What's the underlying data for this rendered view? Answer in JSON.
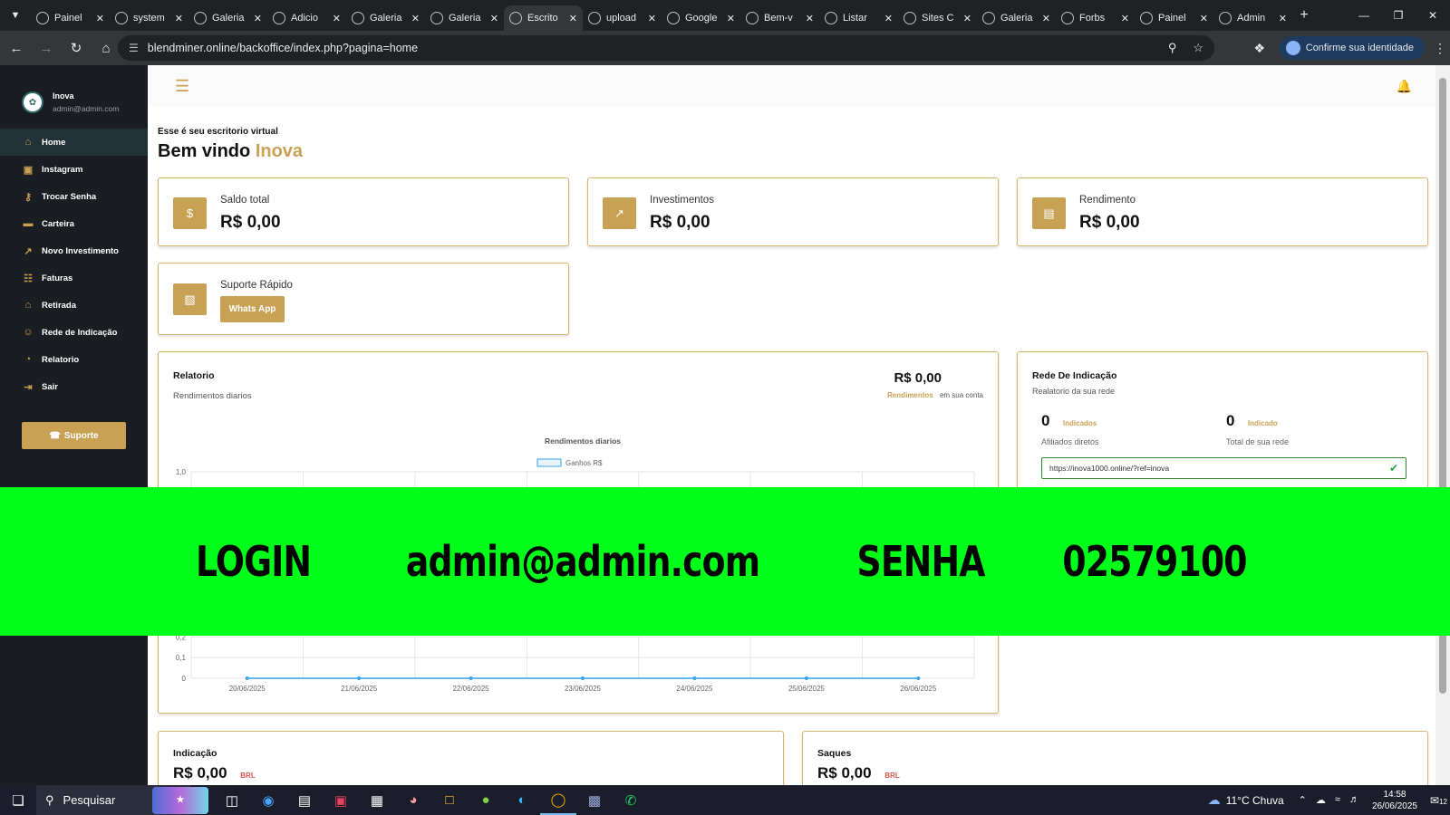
{
  "browser": {
    "tabs": [
      {
        "title": "Painel",
        "icon": "purple-app-icon"
      },
      {
        "title": "system",
        "icon": "globe-icon"
      },
      {
        "title": "Galeria",
        "icon": "globe-icon"
      },
      {
        "title": "Adicio",
        "icon": "globe-icon"
      },
      {
        "title": "Galeria",
        "icon": "globe-icon"
      },
      {
        "title": "Galeria",
        "icon": "globe-icon"
      },
      {
        "title": "Escrito",
        "icon": "gold-site-icon",
        "active": true
      },
      {
        "title": "upload",
        "icon": "blue-site-icon"
      },
      {
        "title": "Google",
        "icon": "gemini-icon"
      },
      {
        "title": "Bem-v",
        "icon": "google-icon"
      },
      {
        "title": "Listar",
        "icon": "globe-icon"
      },
      {
        "title": "Sites C",
        "icon": "globe-icon"
      },
      {
        "title": "Galeria",
        "icon": "globe-icon"
      },
      {
        "title": "Forbs",
        "icon": "chart-site-icon"
      },
      {
        "title": "Painel",
        "icon": "globe-icon"
      },
      {
        "title": "Admin",
        "icon": "globe-icon"
      }
    ],
    "url": "blendminer.online/backoffice/index.php?pagina=home",
    "identity_label": "Confirme sua identidade"
  },
  "sidebar": {
    "user_name": "Inova",
    "user_email": "admin@admin.com",
    "items": [
      {
        "label": "Home",
        "icon": "home-icon"
      },
      {
        "label": "Instagram",
        "icon": "instagram-icon"
      },
      {
        "label": "Trocar Senha",
        "icon": "key-icon"
      },
      {
        "label": "Carteira",
        "icon": "wallet-icon"
      },
      {
        "label": "Novo Investimento",
        "icon": "chart-line-icon"
      },
      {
        "label": "Faturas",
        "icon": "invoice-icon"
      },
      {
        "label": "Retirada",
        "icon": "bank-icon"
      },
      {
        "label": "Rede de Indicação",
        "icon": "users-icon"
      },
      {
        "label": "Relatorio",
        "icon": "pie-chart-icon"
      },
      {
        "label": "Sair",
        "icon": "logout-icon"
      }
    ],
    "support_label": "Suporte"
  },
  "main": {
    "welcome_sub": "Esse é seu escritorio virtual",
    "welcome_prefix": "Bem vindo",
    "welcome_name": "Inova",
    "stats": [
      {
        "label": "Saldo total",
        "value": "R$ 0,00",
        "icon": "dollar-icon"
      },
      {
        "label": "Investimentos",
        "value": "R$ 0,00",
        "icon": "chart-line-icon"
      },
      {
        "label": "Rendimento",
        "value": "R$ 0,00",
        "icon": "money-stack-icon"
      }
    ],
    "support_card": {
      "label": "Suporte Rápido",
      "button": "Whats App"
    },
    "relatorio": {
      "title": "Relatorio",
      "subtitle": "Rendimentos diarios",
      "value": "R$ 0,00",
      "note_highlight": "Rendimentos",
      "note_rest": "em sua conta"
    },
    "rede": {
      "title": "Rede De Indicação",
      "subtitle": "Realatorio da sua rede",
      "stats": [
        {
          "value": "0",
          "tag": "Indicados",
          "desc": "Afiliados diretos"
        },
        {
          "value": "0",
          "tag": "Indicado",
          "desc": "Total de sua rede"
        }
      ],
      "ref_link": "https://inova1000.online/?ref=inova"
    },
    "indicacao": {
      "title": "Indicação",
      "value": "R$ 0,00",
      "currency": "BRL"
    },
    "saques": {
      "title": "Saques",
      "value": "R$ 0,00",
      "currency": "BRL"
    }
  },
  "chart_data": {
    "type": "line",
    "title": "Rendimentos diarios",
    "series": [
      {
        "name": "Ganhos R$",
        "values": [
          0,
          0,
          0,
          0,
          0,
          0,
          0
        ]
      }
    ],
    "categories": [
      "20/06/2025",
      "21/06/2025",
      "22/06/2025",
      "23/06/2025",
      "24/06/2025",
      "25/06/2025",
      "26/06/2025"
    ],
    "ylim": [
      0,
      1
    ],
    "yticks_visible": [
      "1,0",
      "0,2",
      "0,1",
      "0"
    ],
    "grid": true,
    "legend": "top-center"
  },
  "banner": {
    "login_label": "LOGIN",
    "login_value": "admin@admin.com",
    "senha_label": "SENHA",
    "senha_value": "02579100"
  },
  "taskbar": {
    "search_placeholder": "Pesquisar",
    "weather": "11°C  Chuva",
    "time": "14:58",
    "date": "26/06/2025",
    "notifications": "12"
  }
}
